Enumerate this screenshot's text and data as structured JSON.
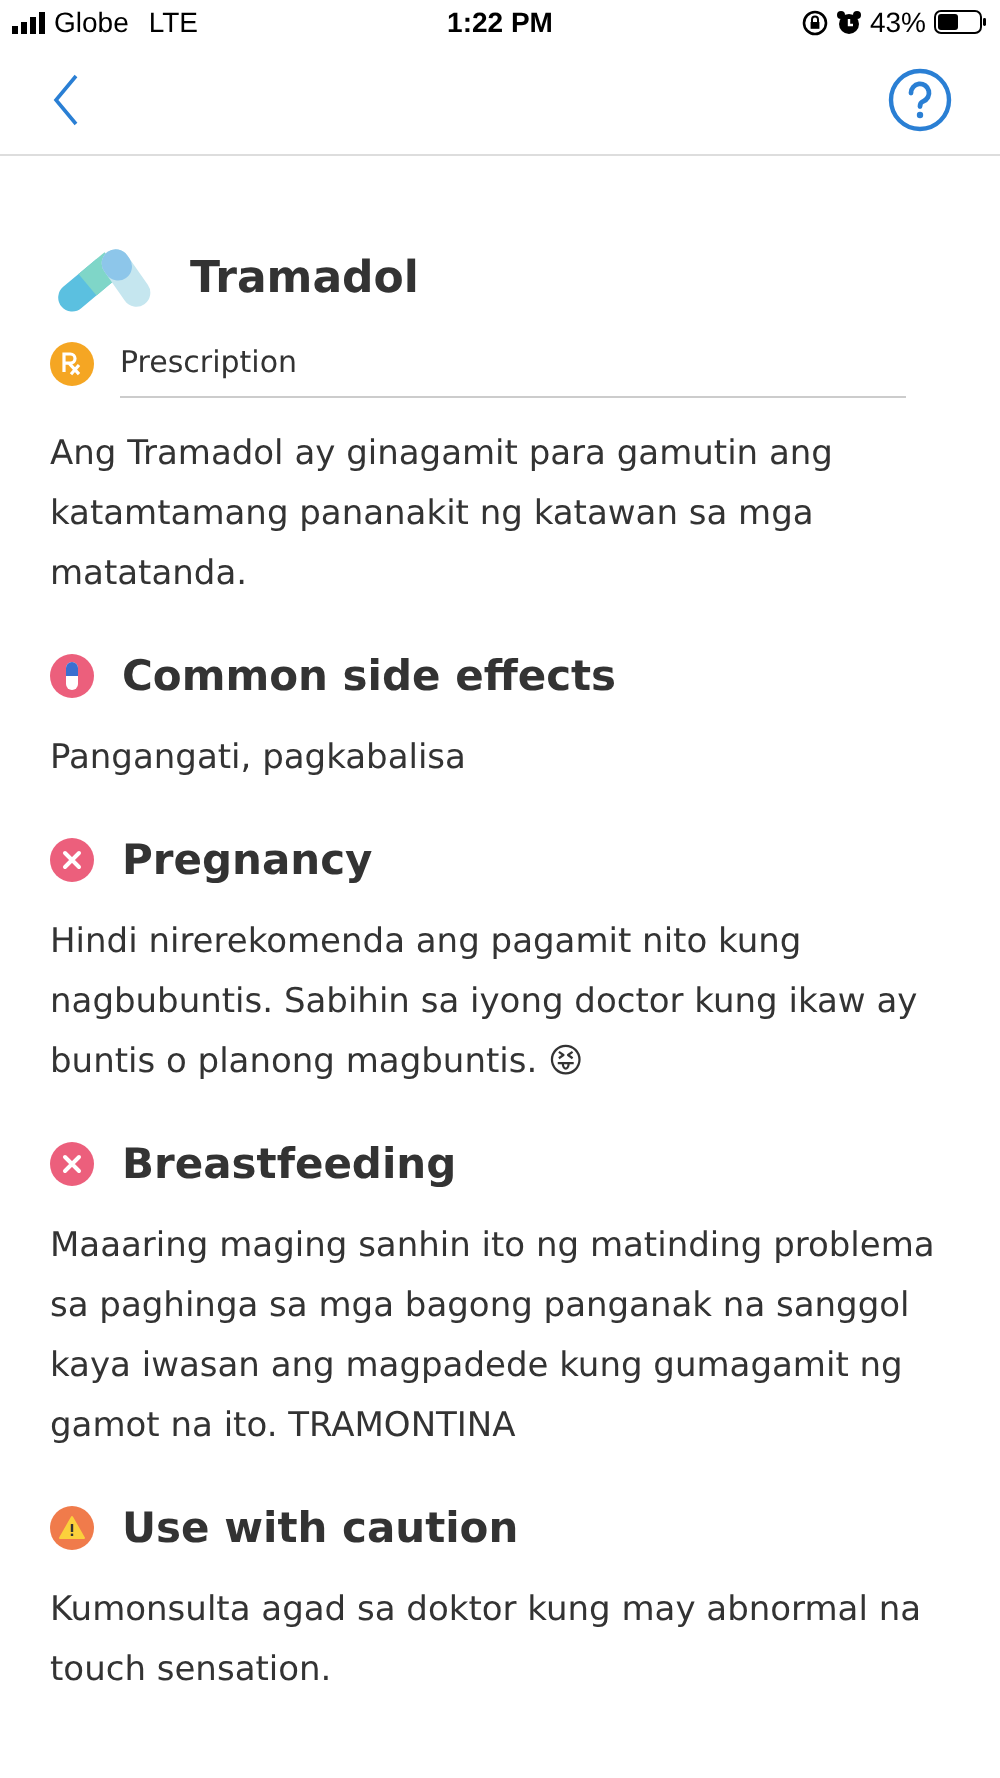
{
  "status_bar": {
    "carrier": "Globe",
    "network": "LTE",
    "time": "1:22 PM",
    "battery": "43%"
  },
  "drug": {
    "name": "Tramadol",
    "type": "Prescription",
    "description": "Ang Tramadol ay ginagamit para gamutin ang katamtamang pananakit ng katawan sa mga matatanda."
  },
  "sections": [
    {
      "kind": "side_effects",
      "title": "Common side effects",
      "text": "Pangangati, pagkabalisa"
    },
    {
      "kind": "avoid",
      "title": "Pregnancy",
      "text": "Hindi nirerekomenda ang pagamit nito kung nagbubuntis. Sabihin sa iyong doctor kung ikaw ay buntis o planong magbuntis. 😝"
    },
    {
      "kind": "avoid",
      "title": "Breastfeeding",
      "text": "Maaaring maging sanhin ito ng matinding problema sa paghinga sa mga bagong panganak na sanggol kaya iwasan ang magpadede kung gumagamit ng gamot na ito.  TRAMONTINA"
    },
    {
      "kind": "caution",
      "title": "Use with caution",
      "text": "Kumonsulta agad sa doktor kung may abnormal na touch sensation."
    }
  ]
}
